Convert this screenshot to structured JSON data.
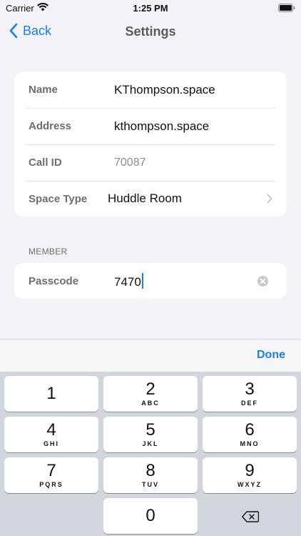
{
  "status_bar": {
    "carrier": "Carrier",
    "time": "1:25 PM"
  },
  "nav": {
    "back_label": "Back",
    "title": "Settings"
  },
  "space": {
    "rows": [
      {
        "label": "Name",
        "value": "KThompson.space"
      },
      {
        "label": "Address",
        "value": "kthompson.space"
      },
      {
        "label": "Call ID",
        "value": "70087"
      },
      {
        "label": "Space Type",
        "value": "Huddle Room"
      }
    ]
  },
  "member": {
    "section_header": "MEMBER",
    "passcode_label": "Passcode",
    "passcode_value": "7470"
  },
  "toolbar": {
    "done_label": "Done"
  },
  "keypad": {
    "keys": [
      {
        "digit": "1",
        "letters": ""
      },
      {
        "digit": "2",
        "letters": "ABC"
      },
      {
        "digit": "3",
        "letters": "DEF"
      },
      {
        "digit": "4",
        "letters": "GHI"
      },
      {
        "digit": "5",
        "letters": "JKL"
      },
      {
        "digit": "6",
        "letters": "MNO"
      },
      {
        "digit": "7",
        "letters": "PQRS"
      },
      {
        "digit": "8",
        "letters": "TUV"
      },
      {
        "digit": "9",
        "letters": "WXYZ"
      },
      {
        "digit": "0",
        "letters": ""
      }
    ]
  },
  "icons": {
    "back": "chevron-left-icon",
    "disclosure": "chevron-right-icon",
    "clear": "clear-circle-icon",
    "delete": "backspace-icon",
    "wifi": "wifi-icon",
    "battery": "battery-icon"
  },
  "colors": {
    "accent": "#1a7ef2",
    "background": "#f2f2f7",
    "keypad": "#d2d5db"
  }
}
